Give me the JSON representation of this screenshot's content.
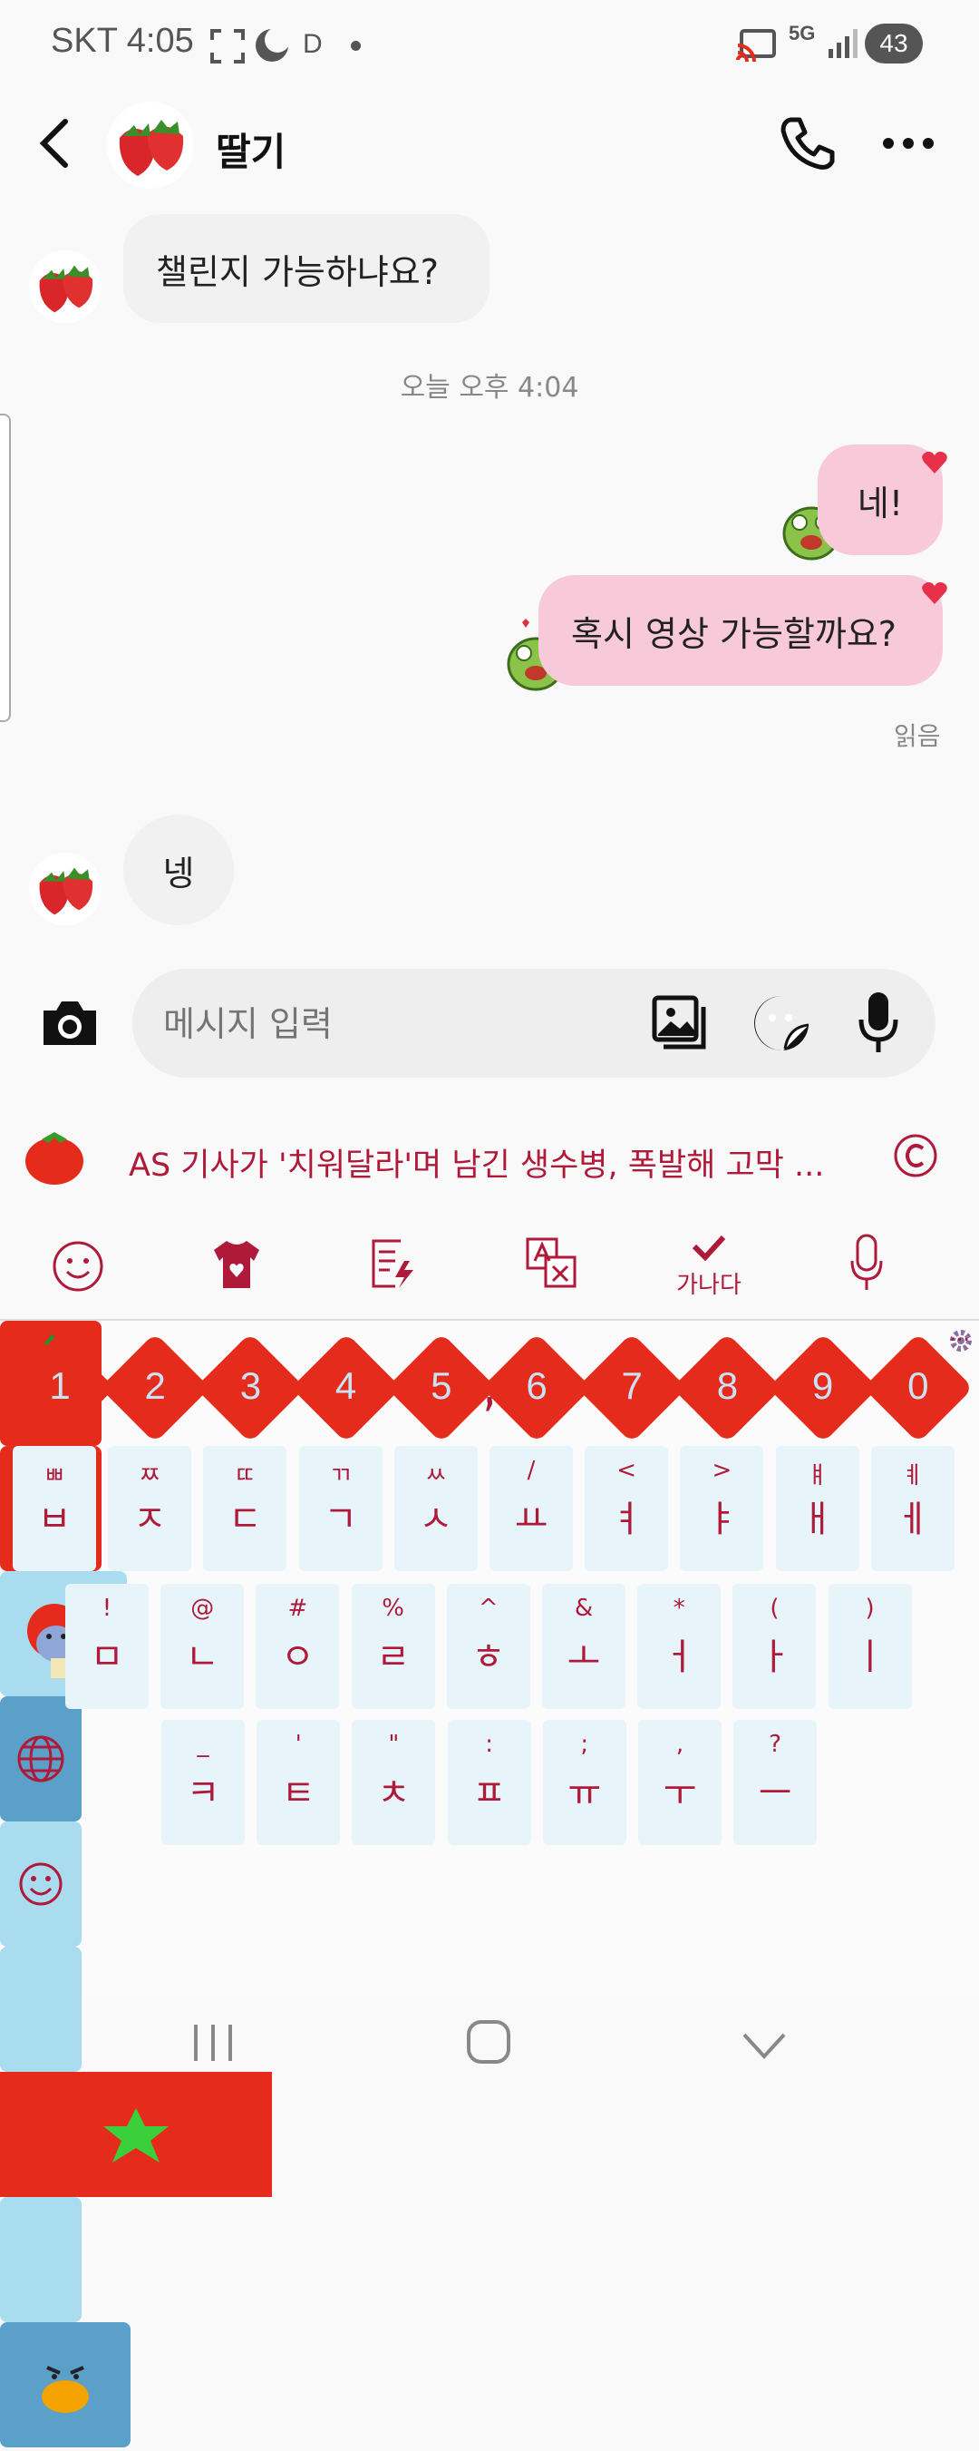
{
  "status_bar": {
    "carrier_time": "SKT 4:05",
    "d_indicator": "D",
    "network": "5G",
    "battery": "43"
  },
  "header": {
    "contact_name": "딸기",
    "back_icon": "chevron-left-icon",
    "call_icon": "phone-icon",
    "more_icon": "more-dots-icon"
  },
  "messages": {
    "incoming_1": "챌린지 가능하냐요?",
    "timestamp": "오늘 오후 4:04",
    "outgoing_1": "네!",
    "outgoing_2": "혹시 영상 가능할까요?",
    "read_status": "읽음",
    "incoming_2": "넹"
  },
  "composer": {
    "placeholder": "메시지 입력",
    "camera_icon": "camera-icon",
    "gallery_icon": "gallery-icon",
    "emoji_icon": "sticker-icon",
    "mic_icon": "mic-icon"
  },
  "news_banner": {
    "text": "AS 기사가 '치워달라'며 남긴 생수병, 폭발해 고막 ..."
  },
  "keyboard_toolbar": {
    "spell_label": "가나다"
  },
  "keyboard": {
    "numbers": [
      "1",
      "2",
      "3",
      "4",
      "5",
      "6",
      "7",
      "8",
      "9",
      "0"
    ],
    "row1": [
      {
        "main": "ㅂ",
        "sub": "ㅃ"
      },
      {
        "main": "ㅈ",
        "sub": "ㅉ"
      },
      {
        "main": "ㄷ",
        "sub": "ㄸ"
      },
      {
        "main": "ㄱ",
        "sub": "ㄲ"
      },
      {
        "main": "ㅅ",
        "sub": "ㅆ"
      },
      {
        "main": "ㅛ",
        "sub": "/"
      },
      {
        "main": "ㅕ",
        "sub": "<"
      },
      {
        "main": "ㅑ",
        "sub": ">"
      },
      {
        "main": "ㅐ",
        "sub": "ㅒ"
      },
      {
        "main": "ㅔ",
        "sub": "ㅖ"
      }
    ],
    "row2": [
      {
        "main": "ㅁ",
        "sub": "!"
      },
      {
        "main": "ㄴ",
        "sub": "@"
      },
      {
        "main": "ㅇ",
        "sub": "#"
      },
      {
        "main": "ㄹ",
        "sub": "%"
      },
      {
        "main": "ㅎ",
        "sub": "^"
      },
      {
        "main": "ㅗ",
        "sub": "&"
      },
      {
        "main": "ㅓ",
        "sub": "*"
      },
      {
        "main": "ㅏ",
        "sub": "("
      },
      {
        "main": "ㅣ",
        "sub": ")"
      }
    ],
    "row3": [
      {
        "main": "ㅋ",
        "sub": "_"
      },
      {
        "main": "ㅌ",
        "sub": "'"
      },
      {
        "main": "ㅊ",
        "sub": "\""
      },
      {
        "main": "ㅍ",
        "sub": ":"
      },
      {
        "main": "ㅠ",
        "sub": ";"
      },
      {
        "main": "ㅜ",
        "sub": ","
      },
      {
        "main": "ㅡ",
        "sub": "?"
      }
    ],
    "comma": ",",
    "period": ".",
    "ellipsis": "..."
  },
  "colors": {
    "accent_red": "#e52c1c",
    "key_bg": "#e7f5fb",
    "key_text": "#b01a3a",
    "outgoing_bubble": "#f8c9d8",
    "incoming_bubble": "#f1f1f1"
  }
}
